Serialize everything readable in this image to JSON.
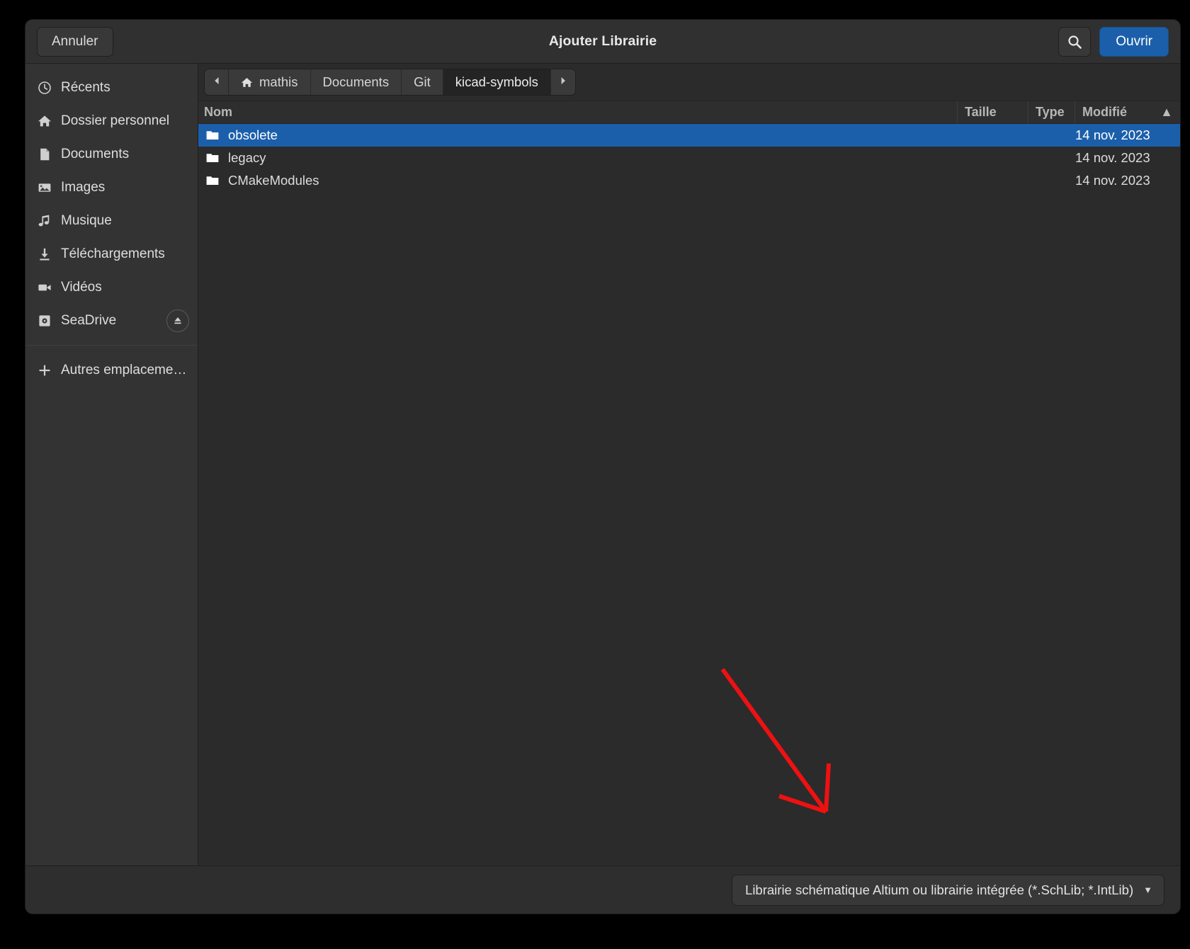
{
  "window": {
    "title": "Ajouter Librairie"
  },
  "header": {
    "cancel_label": "Annuler",
    "open_label": "Ouvrir",
    "search_icon": "search-icon"
  },
  "sidebar": {
    "items": [
      {
        "label": "Récents",
        "icon": "clock-icon"
      },
      {
        "label": "Dossier personnel",
        "icon": "home-icon"
      },
      {
        "label": "Documents",
        "icon": "document-icon"
      },
      {
        "label": "Images",
        "icon": "image-icon"
      },
      {
        "label": "Musique",
        "icon": "music-note-icon"
      },
      {
        "label": "Téléchargements",
        "icon": "download-icon"
      },
      {
        "label": "Vidéos",
        "icon": "video-camera-icon"
      },
      {
        "label": "SeaDrive",
        "icon": "drive-icon",
        "eject": true
      }
    ],
    "other_locations": {
      "label": "Autres emplacements",
      "icon": "plus-icon"
    }
  },
  "pathbar": {
    "back_icon": "chevron-left-icon",
    "forward_icon": "chevron-right-icon",
    "segments": [
      {
        "label": "mathis",
        "icon": "home-icon",
        "active": false
      },
      {
        "label": "Documents",
        "icon": "",
        "active": false
      },
      {
        "label": "Git",
        "icon": "",
        "active": false
      },
      {
        "label": "kicad-symbols",
        "icon": "",
        "active": true
      }
    ]
  },
  "filelist": {
    "columns": {
      "name": "Nom",
      "size": "Taille",
      "type": "Type",
      "modified": "Modifié",
      "sort_caret": "▲"
    },
    "rows": [
      {
        "name": "obsolete",
        "size": "",
        "type": "",
        "modified": "14 nov. 2023",
        "selected": true,
        "icon": "folder-icon"
      },
      {
        "name": "legacy",
        "size": "",
        "type": "",
        "modified": "14 nov. 2023",
        "selected": false,
        "icon": "folder-icon"
      },
      {
        "name": "CMakeModules",
        "size": "",
        "type": "",
        "modified": "14 nov. 2023",
        "selected": false,
        "icon": "folder-icon"
      }
    ]
  },
  "footer": {
    "filter_label": "Librairie schématique Altium ou librairie intégrée (*.SchLib; *.IntLib)",
    "filter_caret": "▼"
  },
  "colors": {
    "accent_blue": "#1b5faa",
    "window_bg": "#2b2b2b",
    "header_bg": "#303030",
    "sidebar_bg": "#333333",
    "annotation_red": "#ee1111"
  },
  "annotation": {
    "type": "arrow",
    "color": "#ee1111",
    "points": "from (1020,945) to (1165,1145)"
  }
}
